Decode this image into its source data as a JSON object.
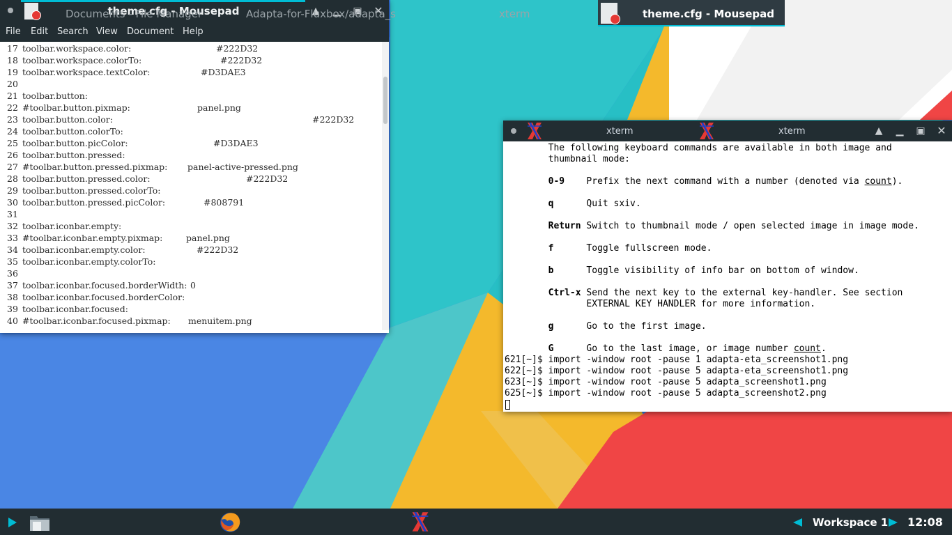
{
  "colors": {
    "titlebar": "#222d32",
    "accent": "#00bcd4",
    "wallpaper_blue": "#3a7be0",
    "wallpaper_teal": "#2ec4c9",
    "wallpaper_yellow": "#f4b92c",
    "wallpaper_red": "#f04545"
  },
  "mousepad": {
    "title": "theme.cfg - Mousepad",
    "app_icon": "text-editor-icon",
    "menu": [
      "File",
      "Edit",
      "Search",
      "View",
      "Document",
      "Help"
    ],
    "lines": [
      {
        "n": "17",
        "key": "toolbar.workspace.color:",
        "val": "#222D32",
        "vx": 310
      },
      {
        "n": "18",
        "key": "toolbar.workspace.colorTo:",
        "val": "#222D32",
        "vx": 316
      },
      {
        "n": "19",
        "key": "toolbar.workspace.textColor:",
        "val": "#D3DAE3",
        "vx": 288
      },
      {
        "n": "20",
        "key": "",
        "val": "",
        "vx": 0
      },
      {
        "n": "21",
        "key": "toolbar.button:",
        "val": "",
        "vx": 0
      },
      {
        "n": "22",
        "key": "#toolbar.button.pixmap:",
        "val": "panel.png",
        "vx": 283
      },
      {
        "n": "23",
        "key": "toolbar.button.color:",
        "val": "#222D32",
        "vx": 448
      },
      {
        "n": "24",
        "key": "toolbar.button.colorTo:",
        "val": "",
        "vx": 0
      },
      {
        "n": "25",
        "key": "toolbar.button.picColor:",
        "val": "#D3DAE3",
        "vx": 306
      },
      {
        "n": "26",
        "key": "toolbar.button.pressed:",
        "val": "",
        "vx": 0
      },
      {
        "n": "27",
        "key": "#toolbar.button.pressed.pixmap:",
        "val": "panel-active-pressed.png",
        "vx": 269
      },
      {
        "n": "28",
        "key": "toolbar.button.pressed.color:",
        "val": "#222D32",
        "vx": 353
      },
      {
        "n": "29",
        "key": "toolbar.button.pressed.colorTo:",
        "val": "",
        "vx": 0
      },
      {
        "n": "30",
        "key": "toolbar.button.pressed.picColor:",
        "val": "#808791",
        "vx": 292
      },
      {
        "n": "31",
        "key": "",
        "val": "",
        "vx": 0
      },
      {
        "n": "32",
        "key": "toolbar.iconbar.empty:",
        "val": "",
        "vx": 0
      },
      {
        "n": "33",
        "key": "#toolbar.iconbar.empty.pixmap:",
        "val": "panel.png",
        "vx": 267
      },
      {
        "n": "34",
        "key": "toolbar.iconbar.empty.color:",
        "val": "#222D32",
        "vx": 282
      },
      {
        "n": "35",
        "key": "toolbar.iconbar.empty.colorTo:",
        "val": "",
        "vx": 0
      },
      {
        "n": "36",
        "key": "",
        "val": "",
        "vx": 0
      },
      {
        "n": "37",
        "key": "toolbar.iconbar.focused.borderWidth:",
        "val": "0",
        "vx": 273
      },
      {
        "n": "38",
        "key": "toolbar.iconbar.focused.borderColor:",
        "val": "",
        "vx": 0
      },
      {
        "n": "39",
        "key": "toolbar.iconbar.focused:",
        "val": "",
        "vx": 0
      },
      {
        "n": "40",
        "key": "#toolbar.iconbar.focused.pixmap:",
        "val": "menuitem.png",
        "vx": 270
      }
    ]
  },
  "xterm": {
    "title_left": "xterm",
    "title_right": "xterm",
    "lines": [
      {
        "segs": [
          {
            "t": "        The following keyboard commands are available in both image and"
          }
        ]
      },
      {
        "segs": [
          {
            "t": "        thumbnail mode:"
          }
        ]
      },
      {
        "segs": [
          {
            "t": ""
          }
        ]
      },
      {
        "segs": [
          {
            "t": "        "
          },
          {
            "t": "0-9",
            "b": true
          },
          {
            "t": "    Prefix the next command with a number (denoted via "
          },
          {
            "t": "count",
            "u": true
          },
          {
            "t": ")."
          }
        ]
      },
      {
        "segs": [
          {
            "t": ""
          }
        ]
      },
      {
        "segs": [
          {
            "t": "        "
          },
          {
            "t": "q",
            "b": true
          },
          {
            "t": "      Quit sxiv."
          }
        ]
      },
      {
        "segs": [
          {
            "t": ""
          }
        ]
      },
      {
        "segs": [
          {
            "t": "        "
          },
          {
            "t": "Return",
            "b": true
          },
          {
            "t": " Switch to thumbnail mode / open selected image in image mode."
          }
        ]
      },
      {
        "segs": [
          {
            "t": ""
          }
        ]
      },
      {
        "segs": [
          {
            "t": "        "
          },
          {
            "t": "f",
            "b": true
          },
          {
            "t": "      Toggle fullscreen mode."
          }
        ]
      },
      {
        "segs": [
          {
            "t": ""
          }
        ]
      },
      {
        "segs": [
          {
            "t": "        "
          },
          {
            "t": "b",
            "b": true
          },
          {
            "t": "      Toggle visibility of info bar on bottom of window."
          }
        ]
      },
      {
        "segs": [
          {
            "t": ""
          }
        ]
      },
      {
        "segs": [
          {
            "t": "        "
          },
          {
            "t": "Ctrl-x",
            "b": true
          },
          {
            "t": " Send the next key to the external key-handler. See section"
          }
        ]
      },
      {
        "segs": [
          {
            "t": "               EXTERNAL KEY HANDLER for more information."
          }
        ]
      },
      {
        "segs": [
          {
            "t": ""
          }
        ]
      },
      {
        "segs": [
          {
            "t": "        "
          },
          {
            "t": "g",
            "b": true
          },
          {
            "t": "      Go to the first image."
          }
        ]
      },
      {
        "segs": [
          {
            "t": ""
          }
        ]
      },
      {
        "segs": [
          {
            "t": "        "
          },
          {
            "t": "G",
            "b": true
          },
          {
            "t": "      Go to the last image, or image number "
          },
          {
            "t": "count",
            "u": true
          },
          {
            "t": "."
          }
        ]
      },
      {
        "segs": [
          {
            "t": "621[~]$ import -window root -pause 1 adapta-eta_screenshot1.png"
          }
        ]
      },
      {
        "segs": [
          {
            "t": "622[~]$ import -window root -pause 5 adapta-eta_screenshot1.png"
          }
        ]
      },
      {
        "segs": [
          {
            "t": "623[~]$ import -window root -pause 5 adapta_screenshot1.png"
          }
        ]
      },
      {
        "segs": [
          {
            "t": "625[~]$ import -window root -pause 5 adapta_screenshot2.png"
          }
        ]
      }
    ]
  },
  "taskbar": {
    "tasks": [
      {
        "label": "Documents - File Manager",
        "icon": "folder-icon"
      },
      {
        "label": "Adapta-for-Fluxbox/adapta_s",
        "icon": "firefox-icon"
      },
      {
        "label": "xterm",
        "icon": "xterm-icon"
      },
      {
        "label": "theme.cfg - Mousepad",
        "icon": "text-editor-icon",
        "active": true
      }
    ],
    "workspace": "Workspace 1",
    "clock": "12:08"
  }
}
